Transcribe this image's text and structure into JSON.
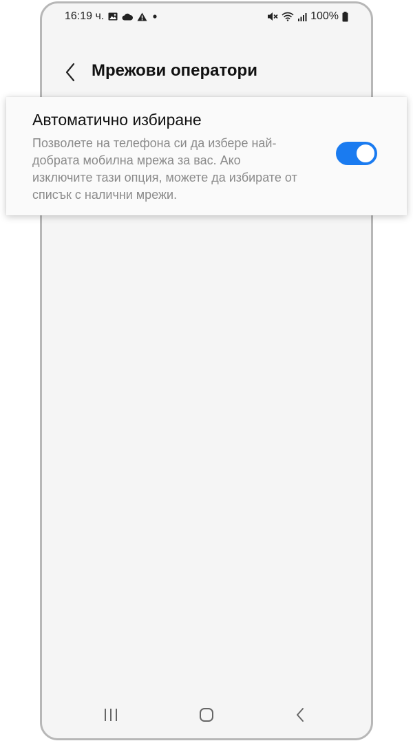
{
  "status_bar": {
    "time": "16:19 ч.",
    "battery": "100%",
    "icons_left": [
      "image-icon",
      "cloud-icon",
      "warning-icon",
      "dot-icon"
    ],
    "icons_right": [
      "mute-icon",
      "wifi-icon",
      "signal-icon",
      "battery-icon"
    ]
  },
  "header": {
    "title": "Мрежови оператори"
  },
  "setting": {
    "title": "Автоматично избиране",
    "description": "Позволете на телефона си да избере най-добрата мобилна мрежа за вас. Ако изключите тази опция, можете да избирате от списък с налични мрежи.",
    "enabled": true
  },
  "nav_bar": {
    "buttons": [
      "recents-icon",
      "home-icon",
      "back-icon"
    ]
  },
  "colors": {
    "accent": "#1a7bf0",
    "background": "#f5f5f5",
    "text_primary": "#111111",
    "text_secondary": "#8a8a8a"
  }
}
